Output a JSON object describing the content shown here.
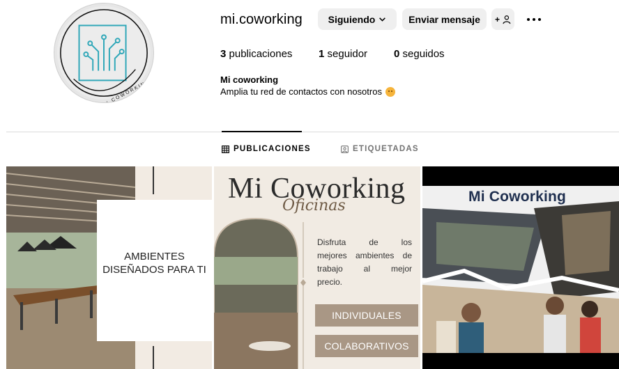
{
  "profile": {
    "username": "mi.coworking",
    "avatar_text": "MI COWORKING",
    "buttons": {
      "following_label": "Siguiendo",
      "message_label": "Enviar mensaje",
      "suggest_label": "+"
    },
    "stats": {
      "posts_count": "3",
      "posts_label": "publicaciones",
      "followers_count": "1",
      "followers_label": "seguidor",
      "following_count": "0",
      "following_label": "seguidos"
    },
    "bio": {
      "name": "Mi coworking",
      "text": "Amplia tu red de contactos con nosotros"
    }
  },
  "tabs": [
    {
      "label": "PUBLICACIONES",
      "icon": "grid-icon",
      "active": true
    },
    {
      "label": "ETIQUETADAS",
      "icon": "tagged-icon",
      "active": false
    }
  ],
  "posts": [
    {
      "text": "AMBIENTES DISEÑADOS PARA TI"
    },
    {
      "title": "Mi Coworking",
      "subtitle": "Oficinas",
      "desc_lines": [
        "Disfruta de los",
        "mejores ambientes de",
        "trabajo al mejor",
        "precio."
      ],
      "button_1": "INDIVIDUALES",
      "button_2": "COLABORATIVOS"
    },
    {
      "title": "Mi Coworking"
    }
  ],
  "colors": {
    "button_bg": "#efefef",
    "muted_text": "#737373",
    "divider": "#dbdbdb",
    "post2_accent": "#a99785",
    "logo_teal": "#2fa7b8"
  }
}
